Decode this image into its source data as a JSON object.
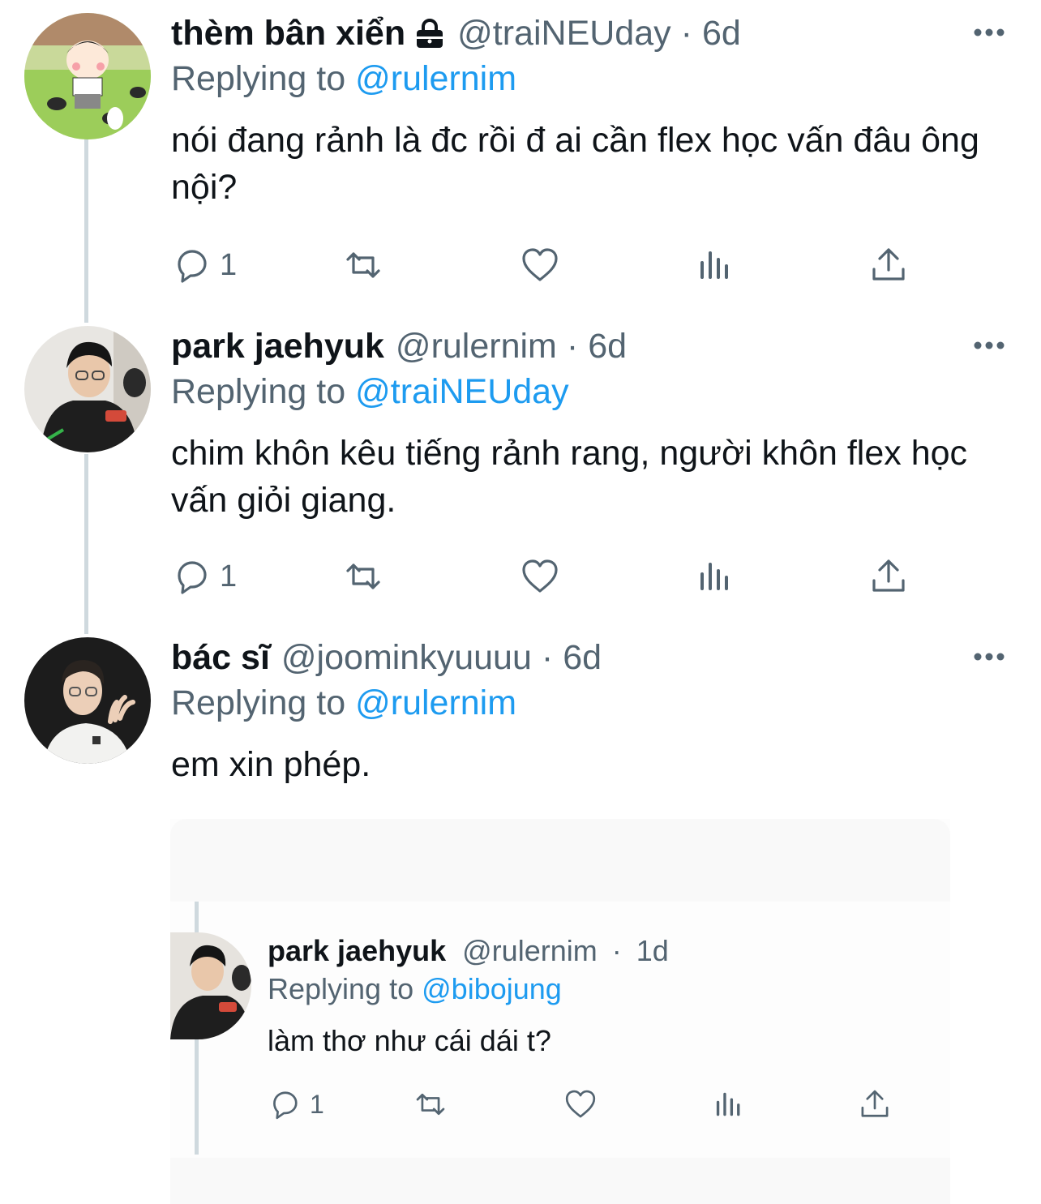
{
  "tweets": [
    {
      "name": "thèm bân xiển",
      "handle": "@traiNEUday",
      "time": "6d",
      "reply_prefix": "Replying to",
      "reply_to": "@rulernim",
      "text": "nói đang rảnh là đc rồi đ ai cần flex học vấn đâu ông nội?",
      "reply_count": "1",
      "protected": true
    },
    {
      "name": "park jaehyuk",
      "handle": "@rulernim",
      "time": "6d",
      "reply_prefix": "Replying to",
      "reply_to": "@traiNEUday",
      "text": "chim khôn kêu tiếng rảnh rang, người khôn flex học vấn giỏi giang.",
      "reply_count": "1"
    },
    {
      "name": "bác sĩ",
      "handle": "@joominkyuuuu",
      "time": "6d",
      "reply_prefix": "Replying to",
      "reply_to": "@rulernim",
      "text": "em xin phép."
    }
  ],
  "quoted": {
    "name": "park jaehyuk",
    "handle": "@rulernim",
    "time": "1d",
    "reply_prefix": "Replying to",
    "reply_to": "@bibojung",
    "text": "làm thơ như cái dái t?",
    "reply_count": "1"
  },
  "icons": [
    "reply-icon",
    "retweet-icon",
    "like-icon",
    "analytics-icon",
    "share-icon",
    "more-icon",
    "lock-icon"
  ],
  "colors": {
    "text": "#0f1419",
    "secondary": "#536471",
    "mention": "#1d9bf0",
    "thread_line": "#cfd9de"
  }
}
